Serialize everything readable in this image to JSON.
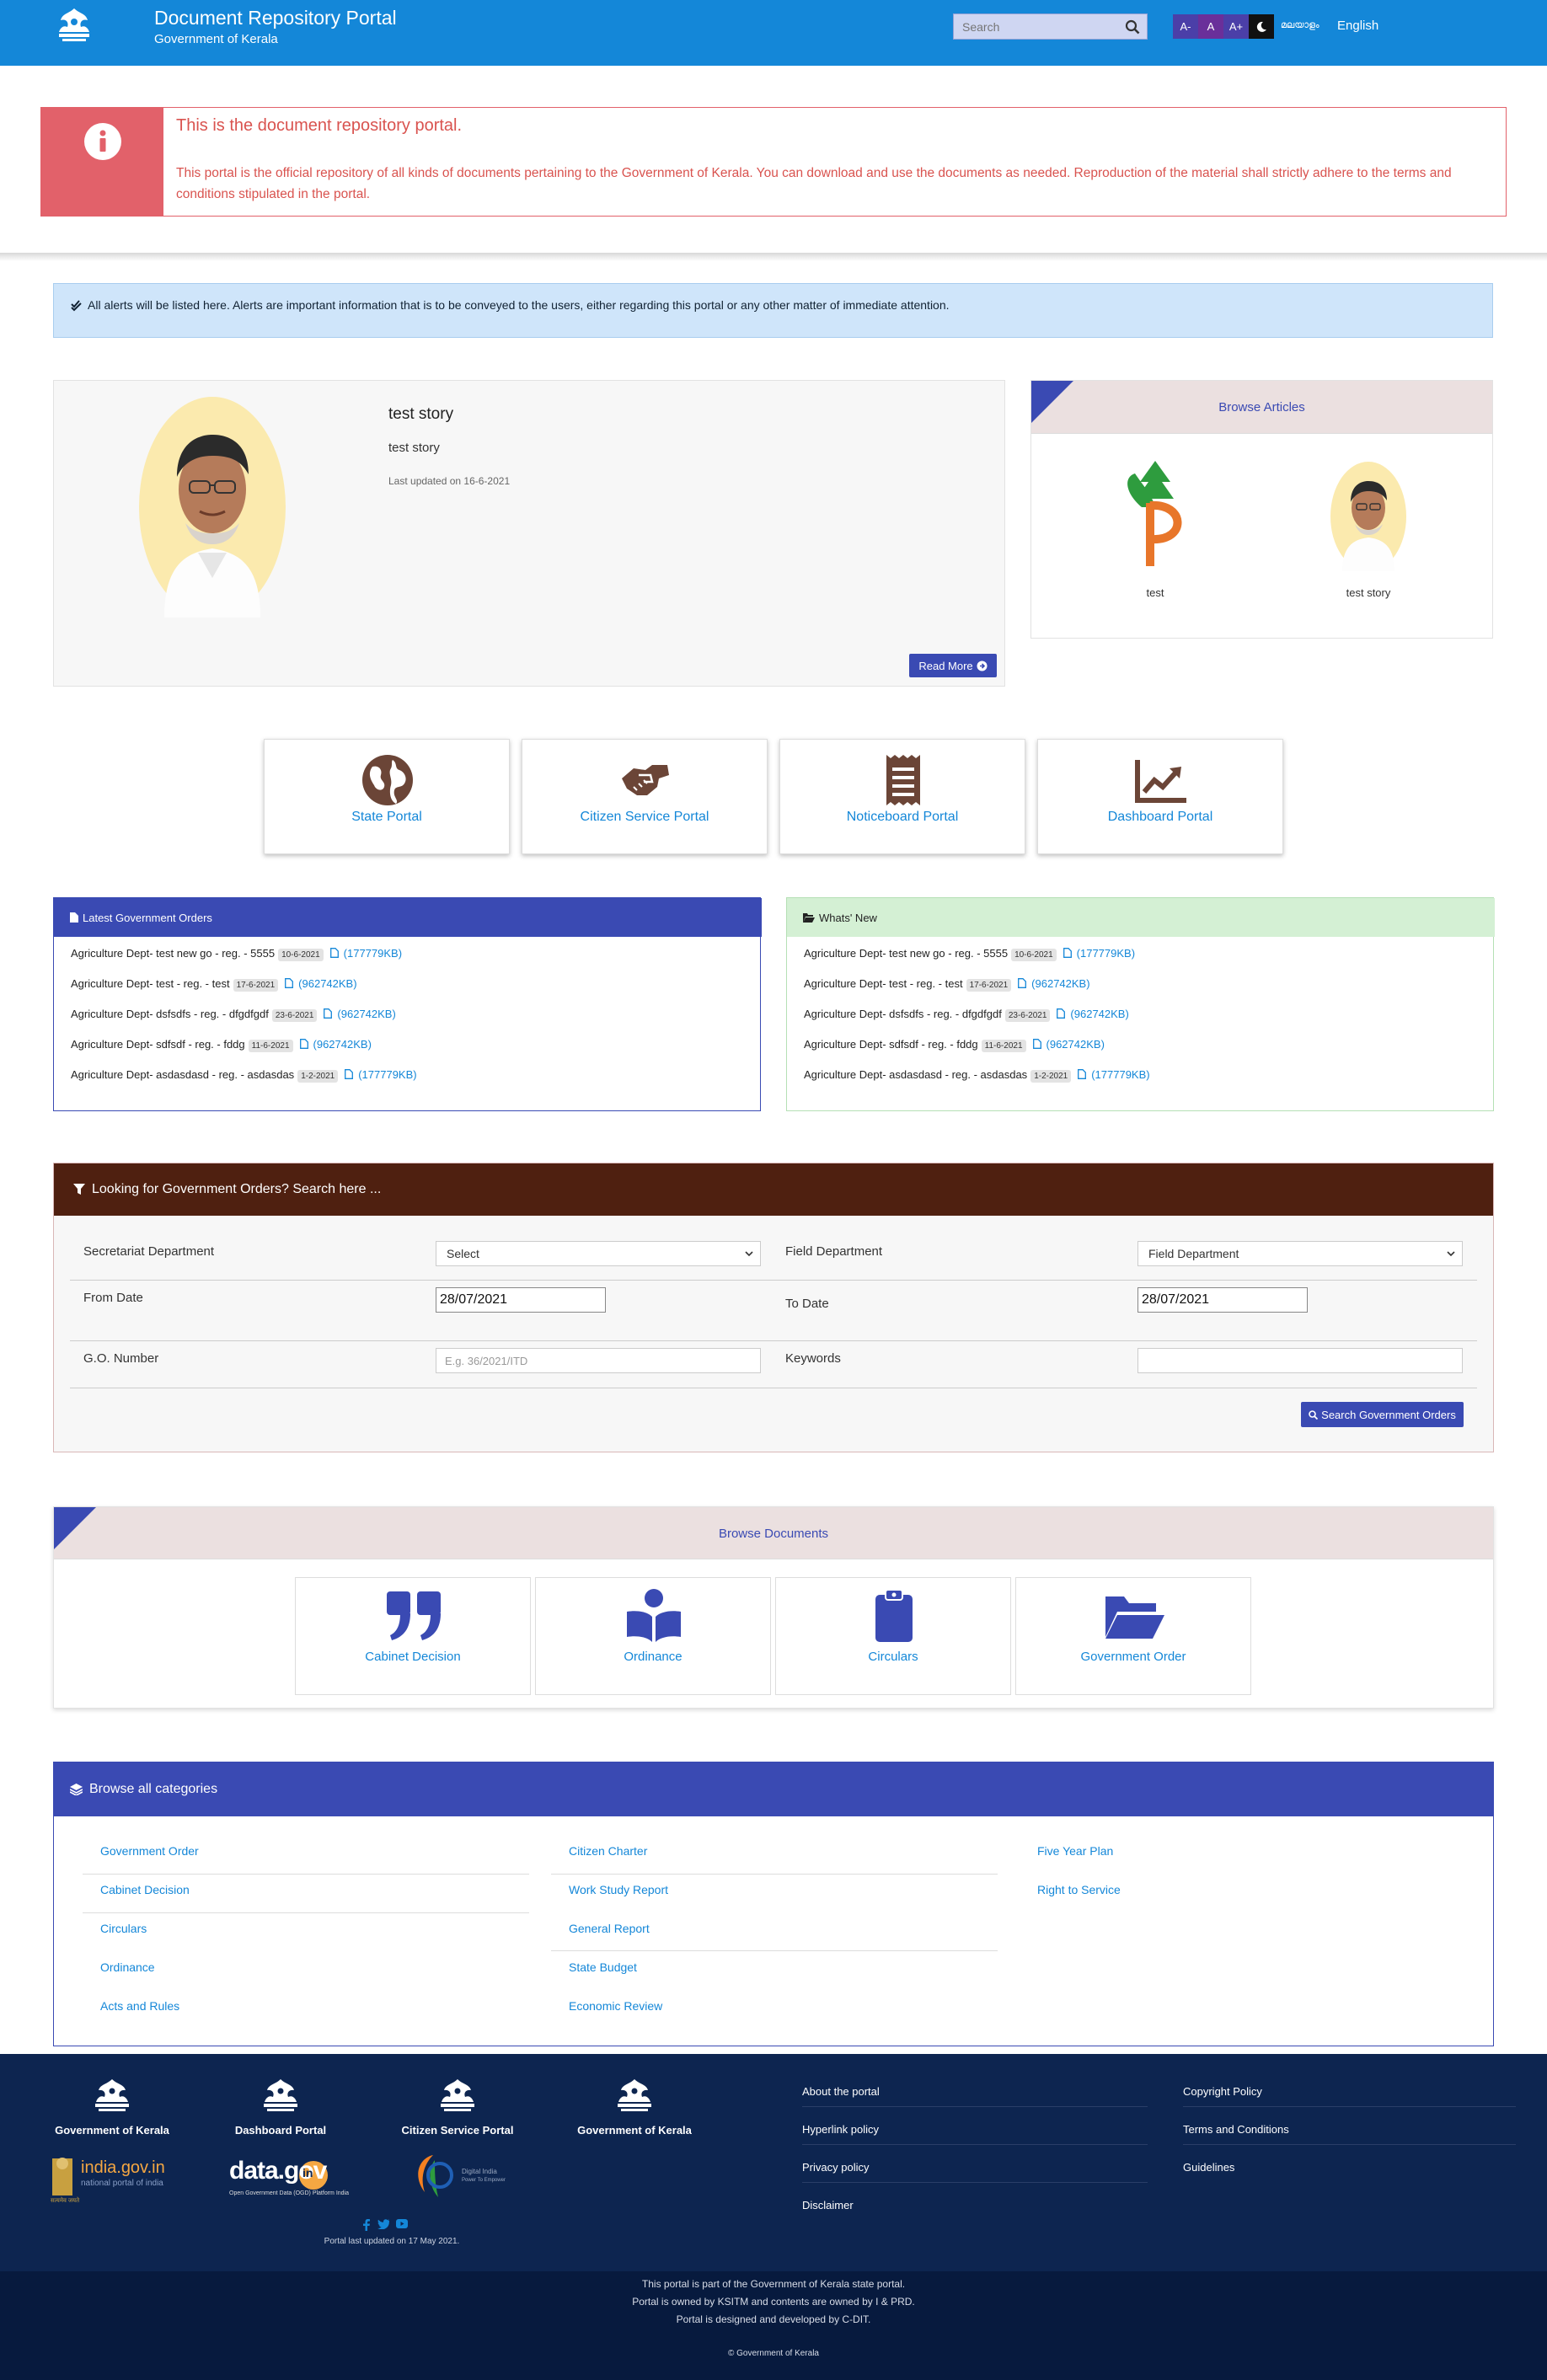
{
  "header": {
    "title": "Document Repository Portal",
    "subtitle": "Government of Kerala",
    "search_placeholder": "Search",
    "font_decrease": "A-",
    "font_normal": "A",
    "font_increase": "A+",
    "lang_malayalam": "മലയാളം",
    "lang_english": "English"
  },
  "intro": {
    "title": "This is the document repository portal.",
    "body": "This portal is the official repository of all kinds of documents pertaining to the Government of Kerala. You can download and use the documents as needed. Reproduction of the material shall strictly adhere to the terms and conditions stipulated in the portal."
  },
  "alert": {
    "text": "All alerts will be listed here. Alerts are important information that is to be conveyed to the users, either regarding this portal or any other matter of immediate attention."
  },
  "story": {
    "title": "test story",
    "summary": "test story",
    "updated": "Last updated on 16-6-2021",
    "read_more": "Read More"
  },
  "articles": {
    "title": "Browse Articles",
    "items": [
      {
        "label": "test"
      },
      {
        "label": "test story"
      }
    ]
  },
  "portals": [
    {
      "label": "State Portal",
      "icon": "globe-icon"
    },
    {
      "label": "Citizen Service Portal",
      "icon": "handshake-icon"
    },
    {
      "label": "Noticeboard Portal",
      "icon": "receipt-icon"
    },
    {
      "label": "Dashboard Portal",
      "icon": "chart-line-icon"
    }
  ],
  "latest_orders": {
    "title": "Latest Government Orders",
    "items": [
      {
        "text": "Agriculture Dept- test new go - reg. - 5555",
        "date": "10-6-2021",
        "size": "(177779KB)"
      },
      {
        "text": "Agriculture Dept- test - reg. - test",
        "date": "17-6-2021",
        "size": "(962742KB)"
      },
      {
        "text": "Agriculture Dept- dsfsdfs - reg. - dfgdfgdf",
        "date": "23-6-2021",
        "size": "(962742KB)"
      },
      {
        "text": "Agriculture Dept- sdfsdf - reg. - fddg",
        "date": "11-6-2021",
        "size": "(962742KB)"
      },
      {
        "text": "Agriculture Dept- asdasdasd - reg. - asdasdas",
        "date": "1-2-2021",
        "size": "(177779KB)"
      }
    ]
  },
  "whats_new": {
    "title": "Whats' New",
    "items": [
      {
        "text": "Agriculture Dept- test new go - reg. - 5555",
        "date": "10-6-2021",
        "size": "(177779KB)"
      },
      {
        "text": "Agriculture Dept- test - reg. - test",
        "date": "17-6-2021",
        "size": "(962742KB)"
      },
      {
        "text": "Agriculture Dept- dsfsdfs - reg. - dfgdfgdf",
        "date": "23-6-2021",
        "size": "(962742KB)"
      },
      {
        "text": "Agriculture Dept- sdfsdf - reg. - fddg",
        "date": "11-6-2021",
        "size": "(962742KB)"
      },
      {
        "text": "Agriculture Dept- asdasdasd - reg. - asdasdas",
        "date": "1-2-2021",
        "size": "(177779KB)"
      }
    ]
  },
  "search_form": {
    "title": "Looking for Government Orders? Search here ...",
    "secretariat_label": "Secretariat Department",
    "secretariat_value": "Select",
    "field_label": "Field Department",
    "field_value": "Field Department",
    "from_label": "From Date",
    "from_value": "28/07/2021",
    "to_label": "To Date",
    "to_value": "28/07/2021",
    "go_label": "G.O. Number",
    "go_placeholder": "E.g. 36/2021/ITD",
    "keywords_label": "Keywords",
    "keywords_value": "",
    "button": "Search Government Orders"
  },
  "documents": {
    "title": "Browse Documents",
    "items": [
      {
        "label": "Cabinet Decision",
        "icon": "quote-icon"
      },
      {
        "label": "Ordinance",
        "icon": "reader-icon"
      },
      {
        "label": "Circulars",
        "icon": "clipboard-icon"
      },
      {
        "label": "Government Order",
        "icon": "folder-open-icon"
      }
    ]
  },
  "categories": {
    "title": "Browse all categories",
    "col1": [
      "Government Order",
      "Cabinet Decision",
      "Circulars",
      "Ordinance",
      "Acts and Rules"
    ],
    "col2": [
      "Citizen Charter",
      "Work Study Report",
      "General Report",
      "State Budget",
      "Economic Review"
    ],
    "col3": [
      "Five Year Plan",
      "Right to Service"
    ]
  },
  "footer": {
    "logos": [
      {
        "caption": "Government of Kerala"
      },
      {
        "caption": "Dashboard Portal"
      },
      {
        "caption": "Citizen Service Portal"
      },
      {
        "caption": "Government of Kerala"
      }
    ],
    "india_gov_name": "india.gov.in",
    "india_gov_tagline": "national portal of india",
    "india_gov_emblem_text": "सत्यमेव जयते",
    "data_gov_name": "data.gov",
    "data_gov_suffix": "in",
    "data_gov_tagline": "Open Government Data (OGD) Platform India",
    "digital_india_name": "Digital India",
    "digital_india_tagline": "Power To Empower",
    "last_updated": "Portal last updated on 17 May 2021.",
    "links_col1": [
      "About the portal",
      "Hyperlink policy",
      "Privacy policy",
      "Disclaimer"
    ],
    "links_col2": [
      "Copyright Policy",
      "Terms and Conditions",
      "Guidelines"
    ],
    "bottom": [
      "This portal is part of the Government of Kerala state portal.",
      "Portal is owned by KSITM and contents are owned by I & PRD.",
      "Portal is designed and developed by C-DIT."
    ],
    "copyright": "Government of Kerala",
    "copyright_symbol": "©"
  }
}
